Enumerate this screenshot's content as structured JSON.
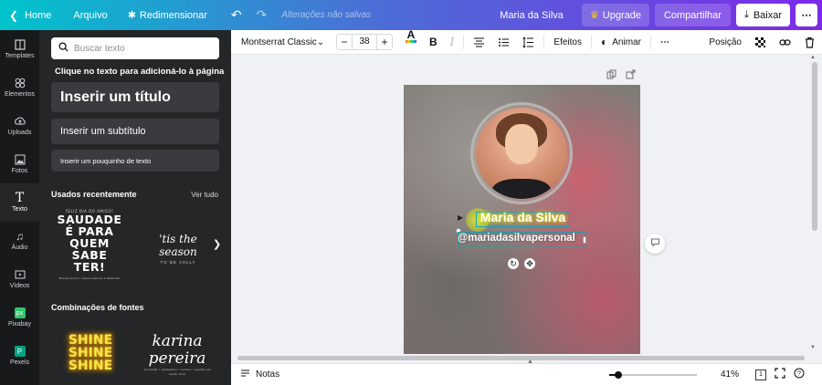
{
  "topbar": {
    "home": "Home",
    "file": "Arquivo",
    "resize": "Redimensionar",
    "unsaved": "Alterações não salvas",
    "user_name": "Maria da Silva",
    "upgrade": "Upgrade",
    "share": "Compartilhar",
    "download": "Baixar"
  },
  "rail": [
    {
      "label": "Templates",
      "icon": "templates-icon"
    },
    {
      "label": "Elementos",
      "icon": "elements-icon"
    },
    {
      "label": "Uploads",
      "icon": "upload-icon"
    },
    {
      "label": "Fotos",
      "icon": "photos-icon"
    },
    {
      "label": "Texto",
      "icon": "text-icon"
    },
    {
      "label": "Áudio",
      "icon": "audio-icon"
    },
    {
      "label": "Vídeos",
      "icon": "video-icon"
    },
    {
      "label": "Pixabay",
      "icon": "pixabay-icon"
    },
    {
      "label": "Pexels",
      "icon": "pexels-icon"
    }
  ],
  "panel": {
    "search_placeholder": "Buscar texto",
    "hint": "Clique no texto para adicioná-lo à página",
    "add_title": "Inserir um título",
    "add_subtitle": "Inserir um subtítulo",
    "add_body": "Inserir um pouquinho de texto",
    "recent_title": "Usados recentemente",
    "see_all": "Ver tudo",
    "saudade_small": "FELIZ DIA DO AMIGO!",
    "saudade_big": "SAUDADE É PARA QUEM SABE TER!",
    "saudade_tiny": "Mande carinho, mesmo estando à distância!",
    "season_script": "'tis the season",
    "season_sub": "TO BE JOLLY",
    "combos_title": "Combinações de fontes",
    "shine": "SHINE SHINE SHINE",
    "karina": "karina pereira",
    "karina_tiny": "fotografia • casamentos • eventos • agende sua sessão 2019"
  },
  "toolbar": {
    "font": "Montserrat Classic",
    "size": "38",
    "effects": "Efeitos",
    "animate": "Animar",
    "position": "Posição"
  },
  "canvas": {
    "name": "Maria da Silva",
    "username": "@mariadasilvapersonal"
  },
  "bottombar": {
    "notes": "Notas",
    "zoom": "41%",
    "zoom_value": 0.41
  }
}
